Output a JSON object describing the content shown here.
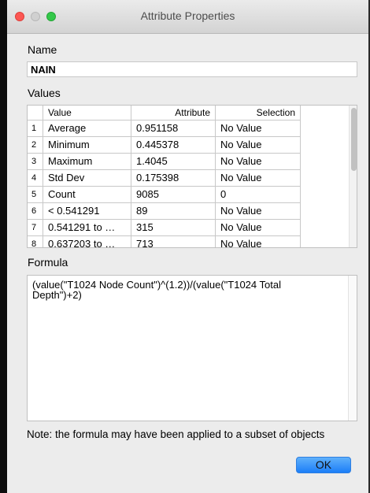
{
  "window": {
    "title": "Attribute Properties"
  },
  "name": {
    "label": "Name",
    "value": "NAIN"
  },
  "values": {
    "label": "Values",
    "columns": [
      "Value",
      "Attribute",
      "Selection"
    ],
    "rows": [
      {
        "n": "1",
        "value": "Average",
        "attribute": "0.951158",
        "selection": "No Value"
      },
      {
        "n": "2",
        "value": "Minimum",
        "attribute": "0.445378",
        "selection": "No Value"
      },
      {
        "n": "3",
        "value": "Maximum",
        "attribute": "1.4045",
        "selection": "No Value"
      },
      {
        "n": "4",
        "value": "Std Dev",
        "attribute": "0.175398",
        "selection": "No Value"
      },
      {
        "n": "5",
        "value": "Count",
        "attribute": "9085",
        "selection": "0"
      },
      {
        "n": "6",
        "value": "< 0.541291",
        "attribute": "89",
        "selection": "No Value"
      },
      {
        "n": "7",
        "value": "0.541291 to …",
        "attribute": "315",
        "selection": "No Value"
      },
      {
        "n": "8",
        "value": "0.637203 to …",
        "attribute": "713",
        "selection": "No Value"
      }
    ]
  },
  "formula": {
    "label": "Formula",
    "line1": "(value(\"T1024 Node Count\")^(1.2))/(value(\"T1024 Total",
    "line2": "Depth\")+2)"
  },
  "note": "Note: the formula may have been applied to a subset of objects",
  "buttons": {
    "ok": "OK"
  },
  "colors": {
    "accent": "#1c7ef8",
    "close": "#fc5753",
    "maximize": "#34c84a"
  }
}
